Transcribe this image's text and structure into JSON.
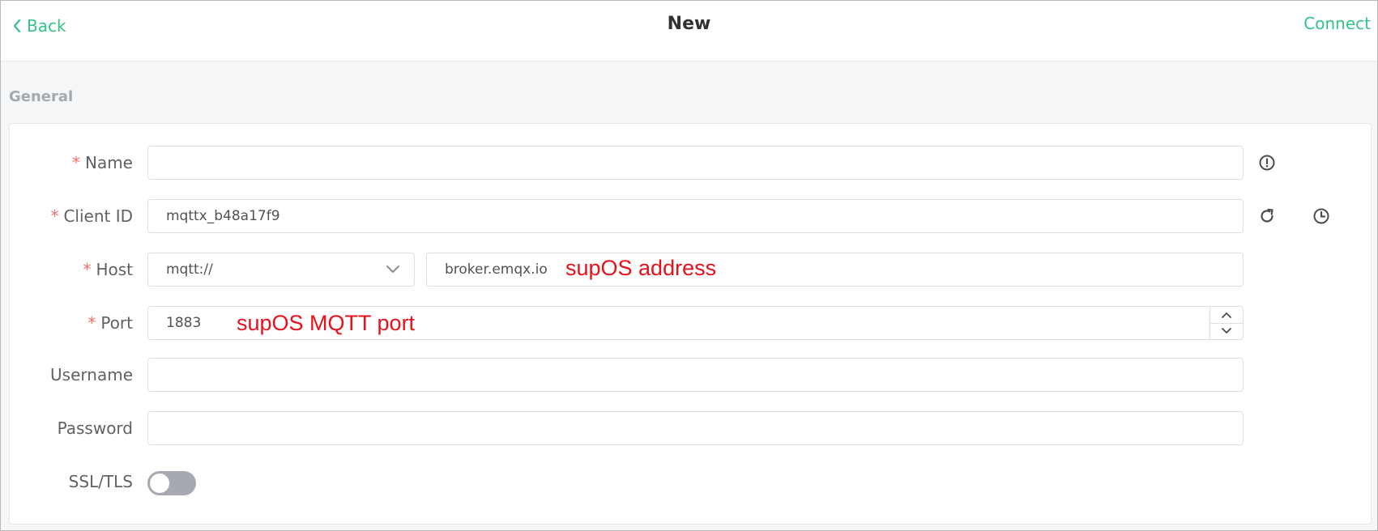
{
  "header": {
    "back_label": "Back",
    "title": "New",
    "connect_label": "Connect"
  },
  "general": {
    "section_title": "General",
    "name": {
      "label": "Name",
      "value": "",
      "required_mark": "*"
    },
    "client_id": {
      "label": "Client ID",
      "value": "mqttx_b48a17f9",
      "required_mark": "*"
    },
    "host": {
      "label": "Host",
      "required_mark": "*",
      "protocol": "mqtt://",
      "value": "broker.emqx.io",
      "annotation": "supOS address"
    },
    "port": {
      "label": "Port",
      "required_mark": "*",
      "value": "1883",
      "annotation": "supOS MQTT port"
    },
    "username": {
      "label": "Username",
      "value": ""
    },
    "password": {
      "label": "Password",
      "value": ""
    },
    "ssl_tls": {
      "label": "SSL/TLS",
      "enabled": false
    }
  },
  "colors": {
    "accent": "#34c388",
    "required": "#f56c6c",
    "annotation": "#e8101a",
    "toggle_off": "#a6aab0"
  },
  "icons": {
    "back": "chevron-left-icon",
    "name_info": "exclamation-circle-icon",
    "refresh": "refresh-icon",
    "history": "clock-icon",
    "protocol_dropdown": "chevron-down-icon",
    "port_up": "chevron-up-icon",
    "port_down": "chevron-down-icon"
  }
}
